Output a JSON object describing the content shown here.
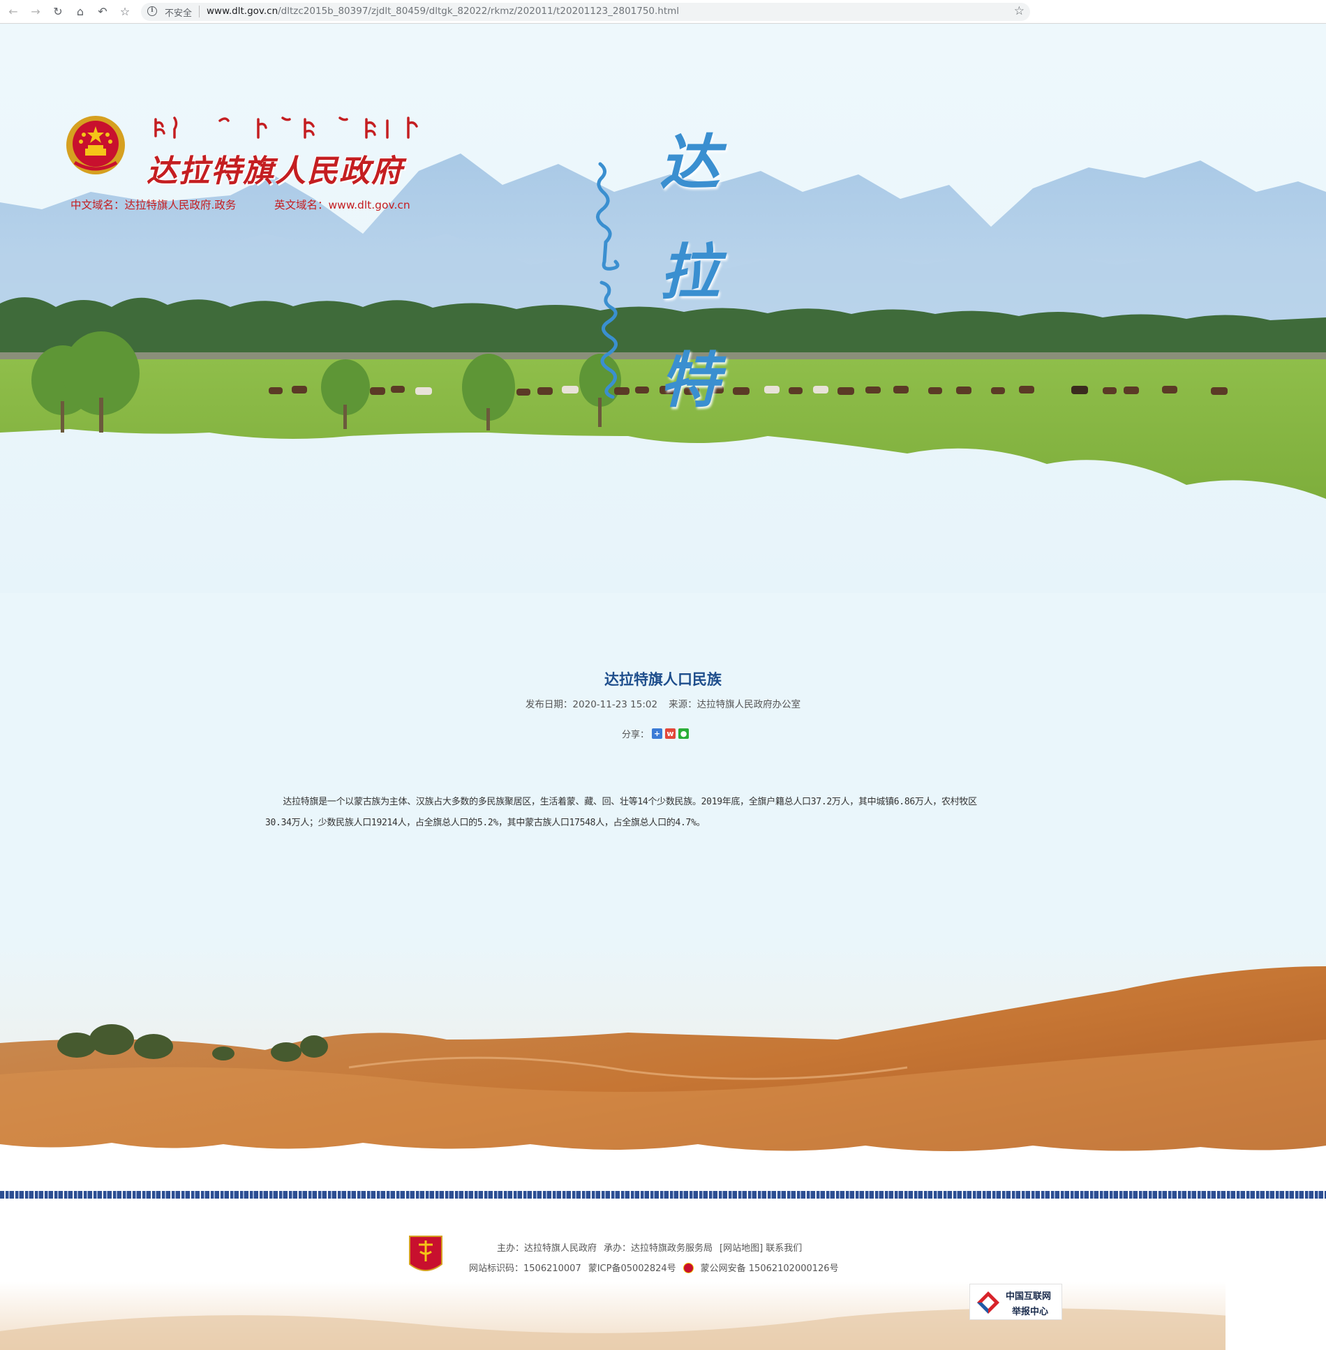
{
  "browser": {
    "back_icon": "arrow-left-icon",
    "forward_icon": "arrow-right-icon",
    "reload_icon": "reload-icon",
    "home_icon": "home-icon",
    "undo_icon": "undo-icon",
    "bookmark_icon": "star-icon",
    "security_label": "不安全",
    "url_host": "www.dlt.gov.cn",
    "url_path": "/dltzc2015b_80397/zjdlt_80459/dltgk_82022/rkmz/202011/t20201123_2801750.html"
  },
  "header": {
    "site_title": "达拉特旗人民政府",
    "domain_cn": "中文域名：达拉特旗人民政府.政务",
    "domain_en": "英文域名：www.dlt.gov.cn",
    "calligraphy": [
      "达",
      "拉",
      "特"
    ]
  },
  "article": {
    "title": "达拉特旗人口民族",
    "publish_date": "发布日期：2020-11-23 15:02",
    "source": "来源：达拉特旗人民政府办公室",
    "share_label": "分享：",
    "body_line1": "　　达拉特旗是一个以蒙古族为主体、汉族占大多数的多民族聚居区，生活着蒙、藏、回、壮等14个少数民族。2019年底，全旗户籍总人口37.2万人，其中城镇6.86万人，农村牧区",
    "body_line2": "30.34万人；少数民族人口19214人，占全旗总人口的5.2%，其中蒙古族人口17548人，占全旗总人口的4.7%。"
  },
  "footer": {
    "sponsor": "主办：达拉特旗人民政府",
    "organizer": "承办：达拉特旗政务服务局",
    "sitemap": "[网站地图]",
    "contact": "联系我们",
    "site_id": "网站标识码：1506210007",
    "icp": "蒙ICP备05002824号",
    "police_record": "蒙公网安备 15062102000126号",
    "report_line1": "中国互联网",
    "report_line2": "举报中心"
  },
  "colors": {
    "brand_red": "#c41e21",
    "title_blue": "#1e4e8c",
    "callig_blue": "#3a8fd0"
  }
}
